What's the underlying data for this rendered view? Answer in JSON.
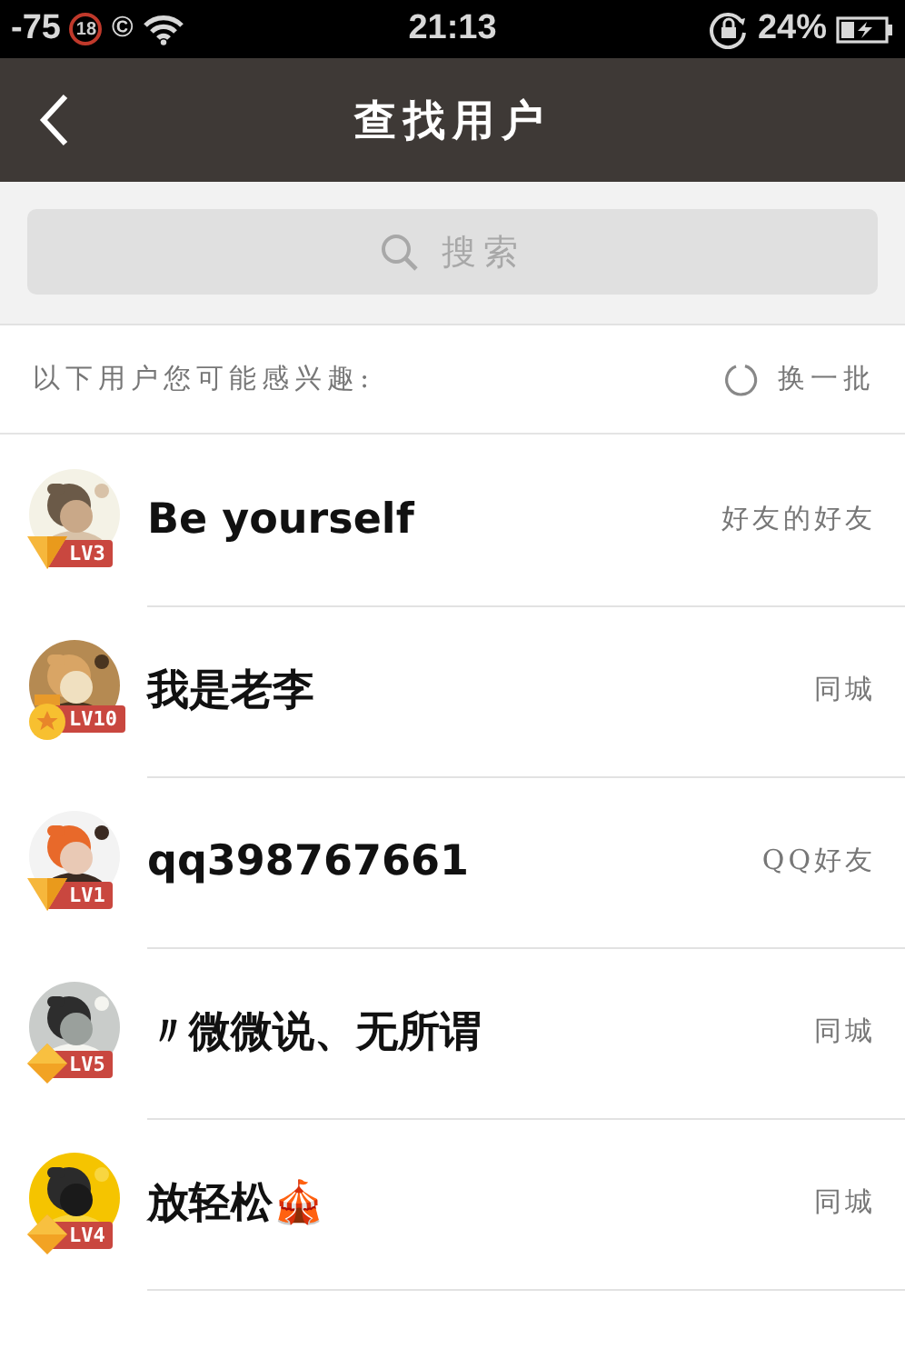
{
  "status_bar": {
    "signal": "-75",
    "badge": "18",
    "symbol": "©",
    "time": "21:13",
    "battery": "24%"
  },
  "nav_bar": {
    "title": "查找用户"
  },
  "search": {
    "placeholder": "搜索"
  },
  "section_header": {
    "text": "以下用户您可能感兴趣:",
    "action": "换一批"
  },
  "users": [
    {
      "name": "Be yourself",
      "level": "LV3",
      "kind": "shield",
      "tag": "好友的好友"
    },
    {
      "name": "我是老李",
      "level": "LV10",
      "kind": "medal",
      "tag": "同城"
    },
    {
      "name": "qq398767661",
      "level": "LV1",
      "kind": "shield",
      "tag": "QQ好友"
    },
    {
      "name": "〃微微说、无所谓",
      "level": "LV5",
      "kind": "diamond",
      "tag": "同城"
    },
    {
      "name": "放轻松🎪",
      "level": "LV4",
      "kind": "diamond",
      "tag": "同城"
    }
  ]
}
